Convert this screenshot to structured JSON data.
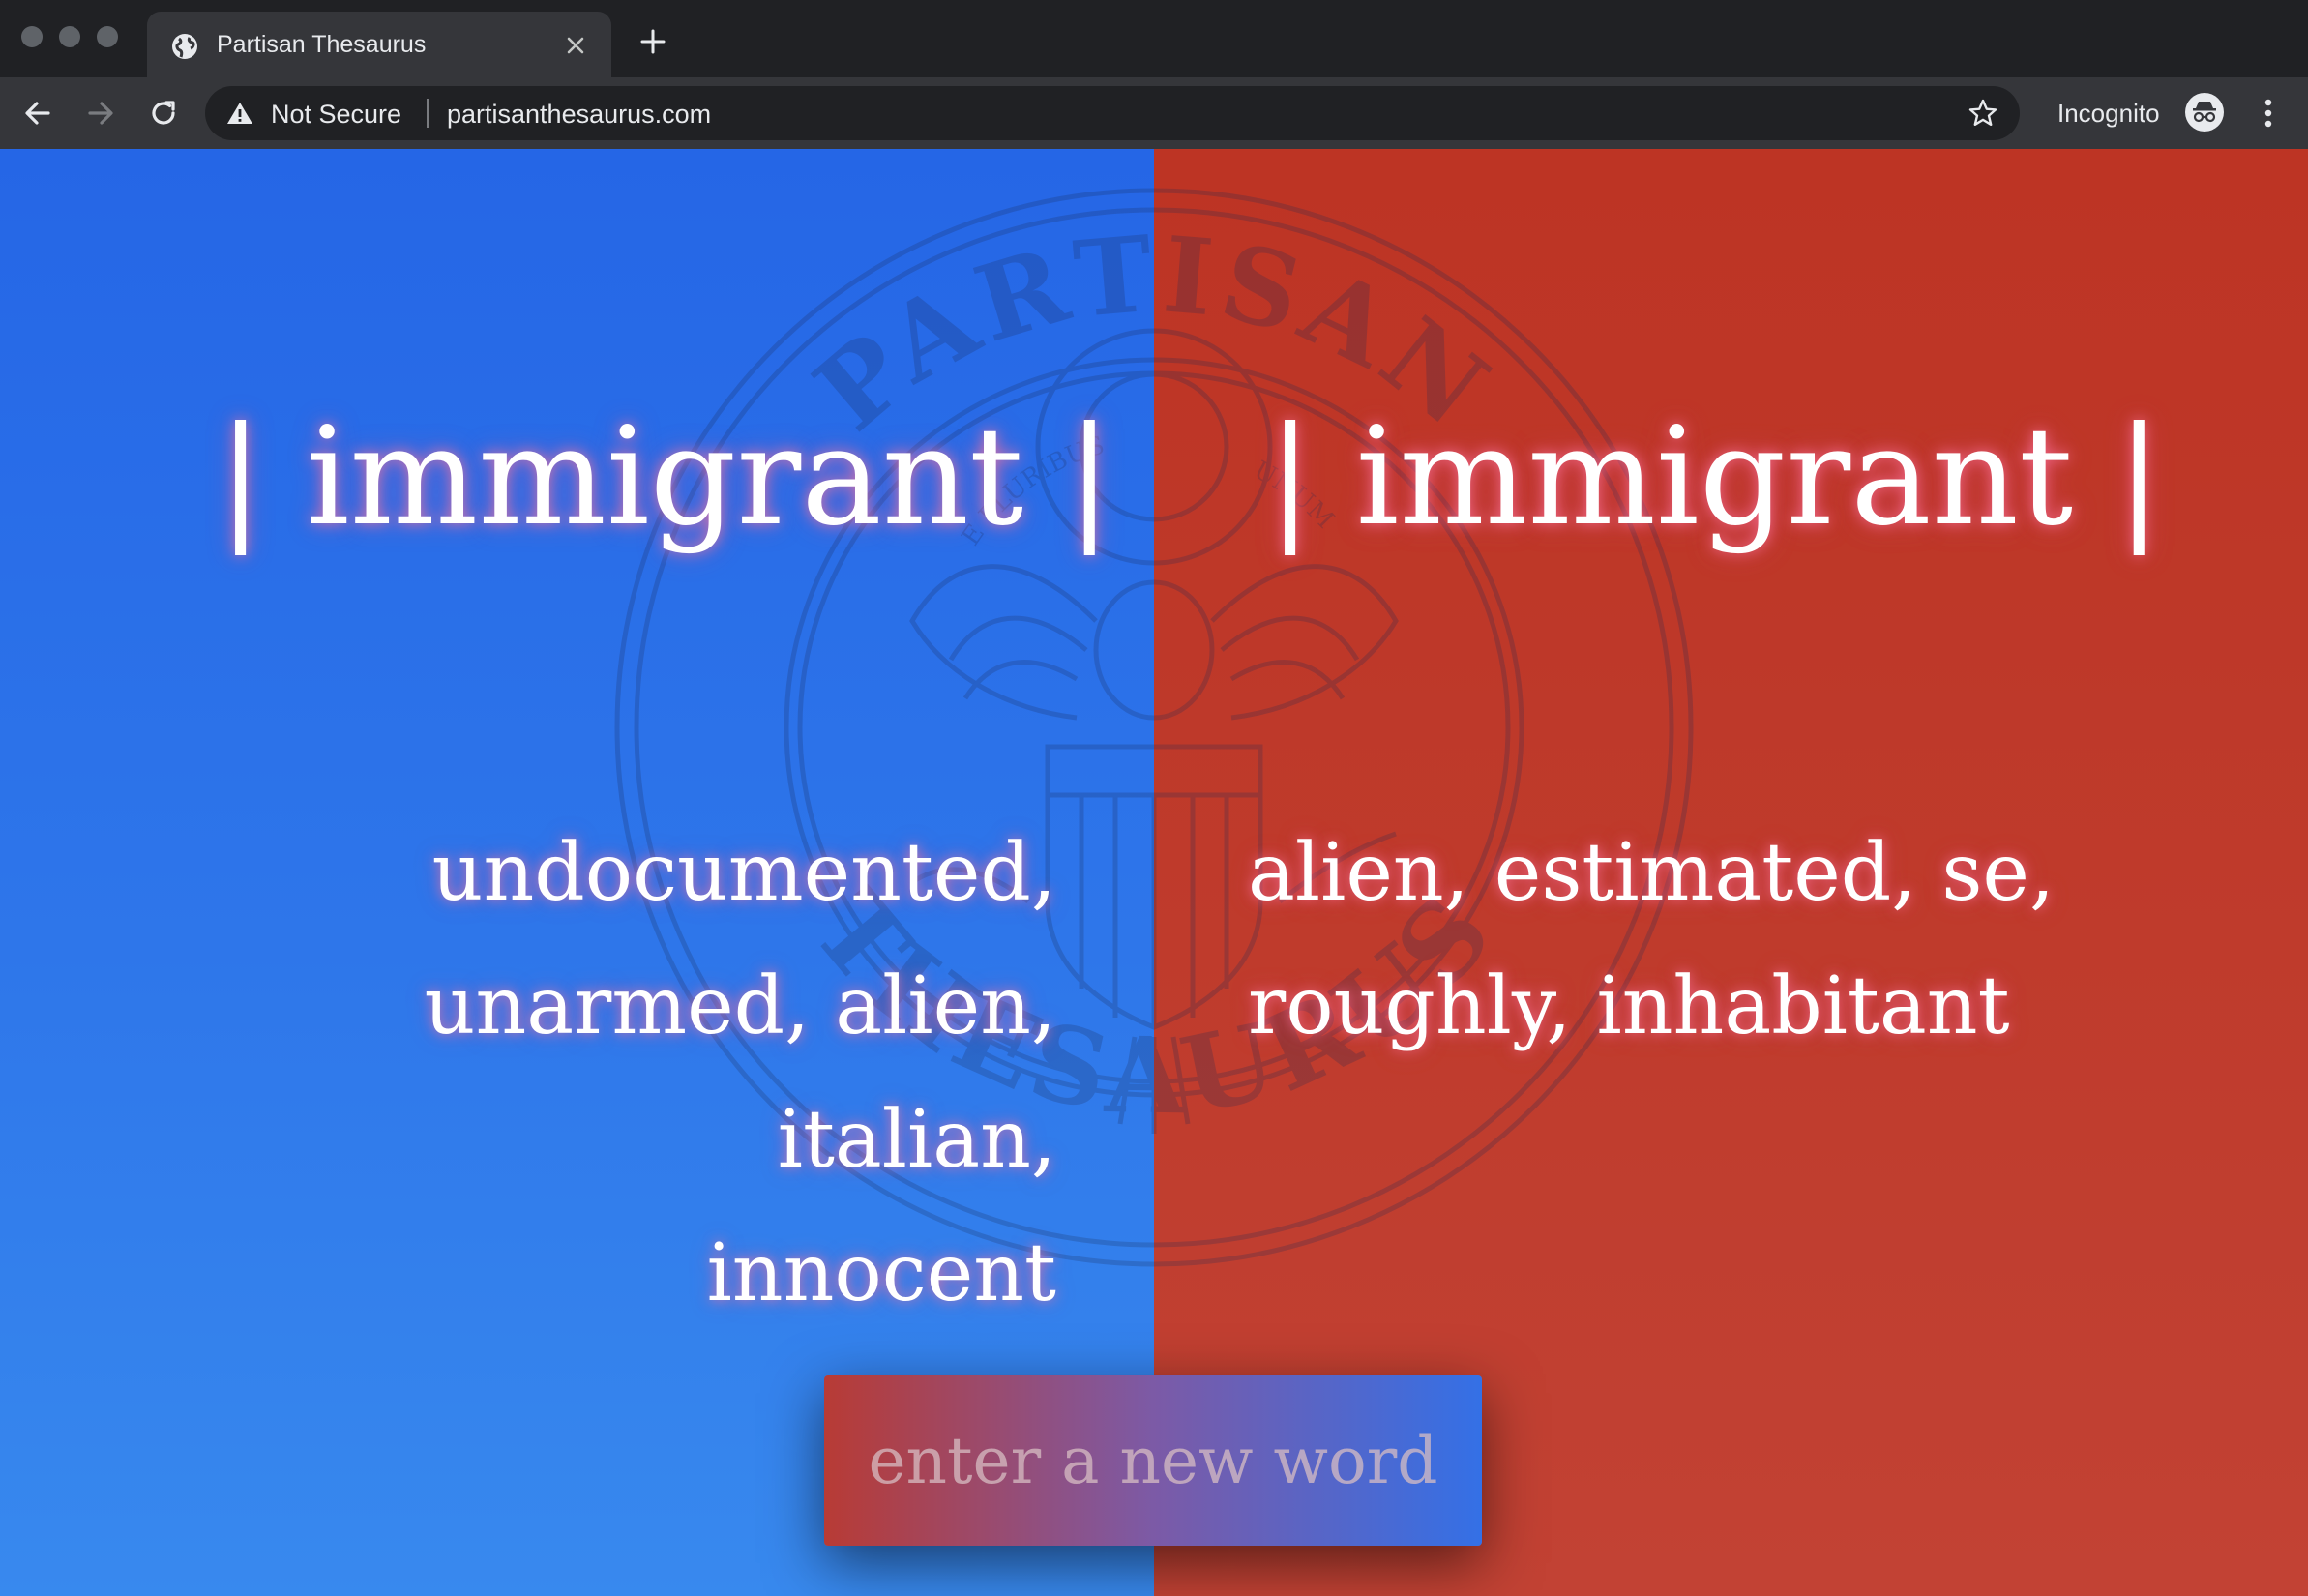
{
  "browser": {
    "tab": {
      "title": "Partisan Thesaurus",
      "icon": "globe-icon"
    },
    "new_tab_icon": "plus-icon",
    "address": {
      "security_label": "Not Secure",
      "url": "partisanthesaurus.com"
    },
    "profile_label": "Incognito"
  },
  "seal": {
    "top_text": "PARTISAN",
    "bottom_text": "THESAURUS",
    "motto_left": "E PLURIBUS",
    "motto_right": "UNUM"
  },
  "left_panel": {
    "word": "| immigrant |",
    "synonyms_line1": "undocumented,",
    "synonyms_line2": "unarmed, alien, italian,",
    "synonyms_line3": "innocent",
    "color": "#2b6fe8"
  },
  "right_panel": {
    "word": "| immigrant |",
    "synonyms_line1": "alien, estimated, se,",
    "synonyms_line2": "roughly, inhabitant",
    "color": "#bf3a2b"
  },
  "entry": {
    "placeholder": "enter a new word",
    "value": ""
  }
}
